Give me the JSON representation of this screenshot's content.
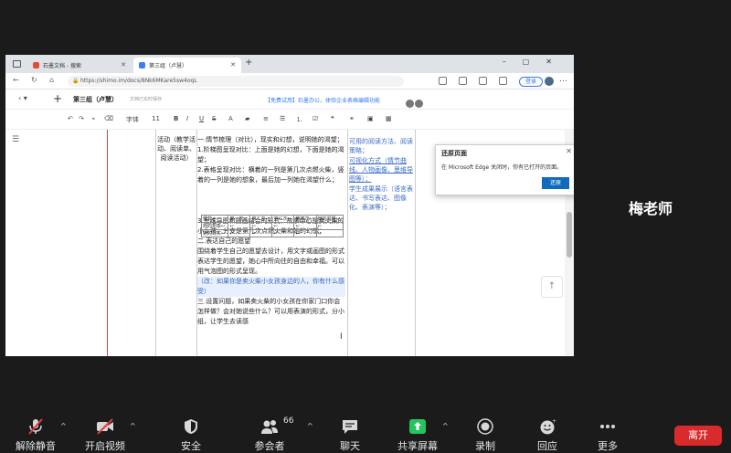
{
  "browser": {
    "tabs": [
      {
        "label": "石墨文档 - 搜索"
      },
      {
        "label": "第三组（卢慧）"
      }
    ],
    "url": "https://shimo.im/docs/8Nk6MKare5sw4oqL",
    "login_label": "登录"
  },
  "doc": {
    "title": "第三组（卢慧）",
    "saved_status": "文档已实时保存",
    "promo": "【免费试用】石墨办公，体验企业表格编辑功能",
    "toolbar": {
      "font": "字体",
      "size": "11"
    },
    "left_cell": "活动（教学活动、阅读单、阅读活动）",
    "mid_lines": [
      "一.情节梳理（对比），现实和幻想，说明她的渴望；",
      "1.阶梯图呈现对比：上面是她的幻想，下面是她的渴望；",
      "2.表格呈现对比：横着的一列是第几次点燃火柴，竖着的一列是她的想象，最后加一列她在渴望什么；",
      "3.思维导图和圆画结合的形式：故事中心是卖火柴的小女孩，分支是第几次点燃火柴和她的幻想；",
      "二.表达自己的愿望",
      "围绕着学生自己的愿望去设计，用文字或画图的形式表达学生的愿望，她心中所向往的自由和幸福。可以用气泡图的形式呈现。",
      "（改：如果你是卖火柴小女孩身边的人，你有什么感受）",
      "三.设置问题，如果卖火柴的小女孩在你家门口你会怎样做？会对她说些什么？可以用表演的形式，分小组，让学生去读感"
    ],
    "mini_table": {
      "header": [
        "情节↩",
        "第一次↩",
        "第二次↩",
        "第三次↩",
        "第四次↩",
        "她的渴望↩"
      ],
      "rows": [
        [
          "她的想象↩",
          "↩",
          "↩",
          "↩",
          "↩",
          "↩"
        ],
        [
          "她的现实↩",
          "↩",
          "↩",
          "↩",
          "↩",
          "↩"
        ]
      ]
    },
    "right_lines": [
      "可用的阅读方法、阅读策略；",
      "可视化方式（情节曲线、人物画像、思维导图等）；",
      "学生成果展示（语言表达、书写表达、图像化、表演等）；"
    ]
  },
  "popup": {
    "title": "还原页面",
    "message": "在 Microsoft Edge 关闭时，你有已打开的页面。",
    "button": "还原"
  },
  "participant": {
    "name": "梅老师"
  },
  "zoom_toolbar": {
    "mute": "解除静音",
    "video": "开启视频",
    "security": "安全",
    "participants": "参会者",
    "participants_count": "66",
    "chat": "聊天",
    "share": "共享屏幕",
    "record": "录制",
    "reactions": "回应",
    "more": "更多",
    "leave": "离开"
  },
  "colors": {
    "share_green": "#23c55e",
    "leave_red": "#d92b2b",
    "link_blue": "#3478f6"
  }
}
